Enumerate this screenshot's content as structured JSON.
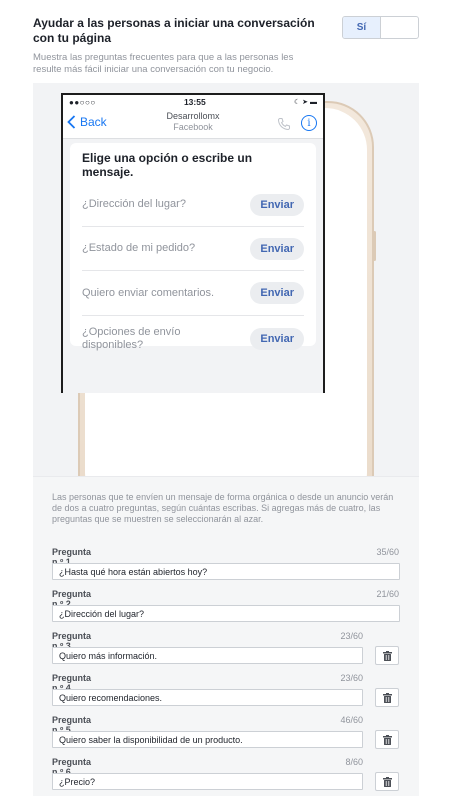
{
  "header": {
    "title": "Ayudar a las personas a iniciar una conversación con tu página",
    "description": "Muestra las preguntas frecuentes para que a las personas les resulte más fácil iniciar una conversación con tu negocio.",
    "toggle_on_label": "Sí"
  },
  "phone_preview": {
    "status_left": "●●○○○ ",
    "status_time": "13:55",
    "status_right": "☾ ➤ ▬",
    "back_label": "Back",
    "page_name": "Desarrollomx",
    "page_subtitle": "Facebook",
    "card_title": "Elige una opción o escribe un mensaje.",
    "send_label": "Enviar",
    "questions": [
      "¿Dirección del lugar?",
      "¿Estado de mi pedido?",
      "Quiero enviar comentarios.",
      "¿Opciones de envío disponibles?"
    ]
  },
  "form": {
    "info": "Las personas que te envíen un mensaje de forma orgánica o desde un anuncio verán de dos a cuatro preguntas, según cuántas escribas. Si agregas más de cuatro, las preguntas que se muestren se seleccionarán al azar.",
    "questions": [
      {
        "label": "Pregunta n.º 1",
        "count": "35/60",
        "value": "¿Hasta qué hora están abiertos hoy?",
        "deletable": false
      },
      {
        "label": "Pregunta n.º 2",
        "count": "21/60",
        "value": "¿Dirección del lugar?",
        "deletable": false
      },
      {
        "label": "Pregunta n.º 3",
        "count": "23/60",
        "value": "Quiero más información.",
        "deletable": true
      },
      {
        "label": "Pregunta n.º 4",
        "count": "23/60",
        "value": "Quiero recomendaciones.",
        "deletable": true
      },
      {
        "label": "Pregunta n.º 5",
        "count": "46/60",
        "value": "Quiero saber la disponibilidad de un producto.",
        "deletable": true
      },
      {
        "label": "Pregunta n.º 6",
        "count": "8/60",
        "value": "¿Precio?",
        "deletable": true
      }
    ]
  },
  "colors": {
    "accent": "#4267b2",
    "ios_blue": "#1877f2"
  },
  "icons": {
    "back": "chevron-left-icon",
    "call": "phone-icon",
    "info": "info-icon",
    "delete": "trash-icon"
  }
}
